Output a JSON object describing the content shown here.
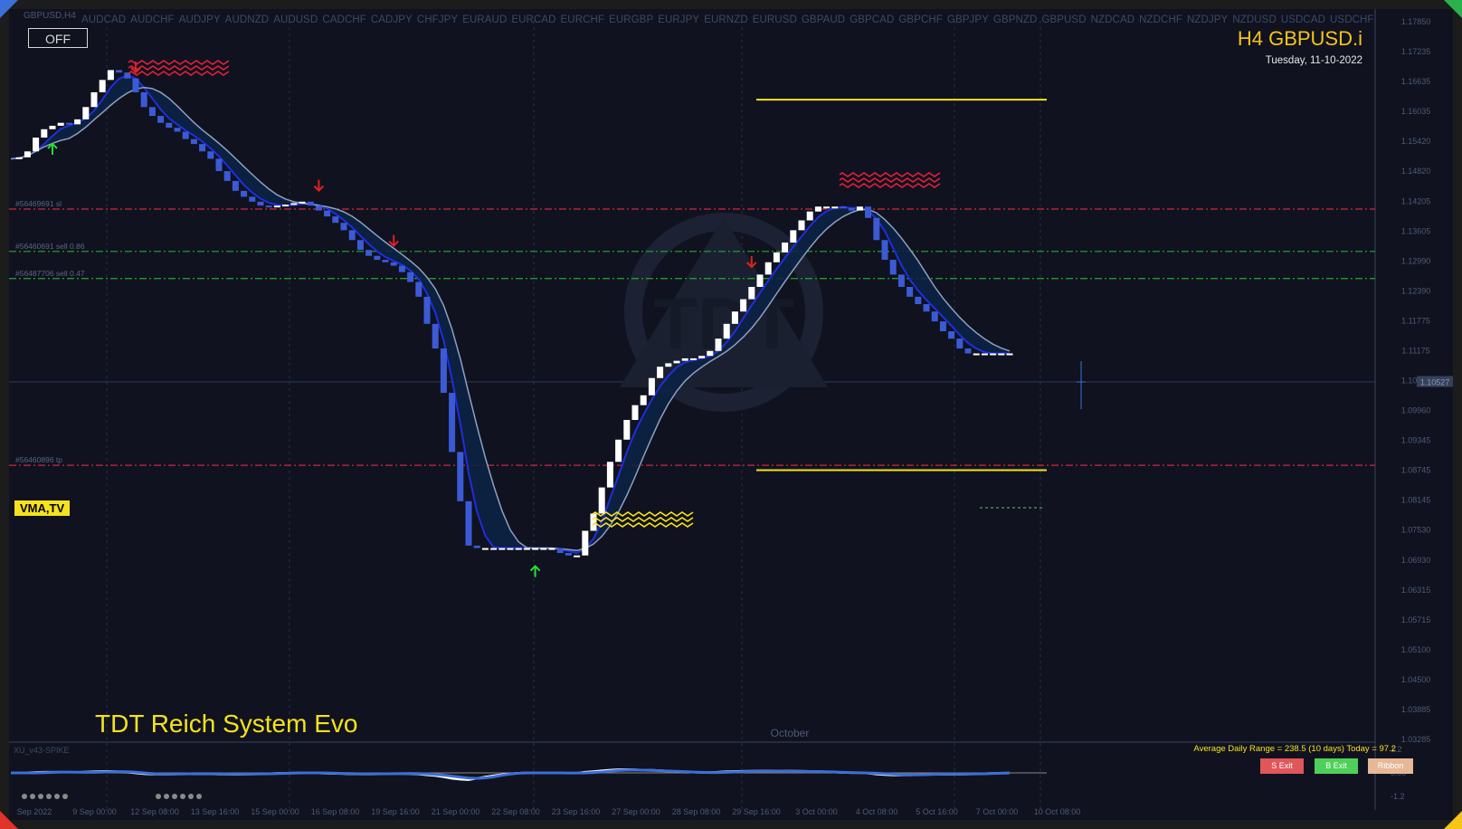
{
  "window": {
    "title": "GBPUSD,H4"
  },
  "symbols": [
    "AUDCAD",
    "AUDCHF",
    "AUDJPY",
    "AUDNZD",
    "AUDUSD",
    "CADCHF",
    "CADJPY",
    "CHFJPY",
    "EURAUD",
    "EURCAD",
    "EURCHF",
    "EURGBP",
    "EURJPY",
    "EURNZD",
    "EURUSD",
    "GBPAUD",
    "GBPCAD",
    "GBPCHF",
    "GBPJPY",
    "GBPNZD",
    "GBPUSD",
    "NZDCAD",
    "NZDCHF",
    "NZDJPY",
    "NZDUSD",
    "USDCAD",
    "USDCHF"
  ],
  "off_button": "OFF",
  "header": {
    "title": "H4 GBPUSD.i",
    "date": "Tuesday, 11-10-2022"
  },
  "badge": "VMA,TV",
  "system_title": "TDT Reich System Evo",
  "month_label": "October",
  "watermark": "TDT",
  "order_lines": [
    {
      "label": "#56469691 sl",
      "price": 1.1403,
      "color": "#d0283c"
    },
    {
      "label": "#56460691 sell 0.86",
      "price": 1.1317,
      "color": "#22aa33"
    },
    {
      "label": "#56487706 sell 0.47",
      "price": 1.1262,
      "color": "#22aa33"
    },
    {
      "label": "#56460896 tp",
      "price": 1.0883,
      "color": "#d0283c"
    }
  ],
  "current_price": "1.10527",
  "adr_text": "Average Daily Range = 238.5 (10 days)   Today = 97.2",
  "buttons": {
    "s_exit": "S Exit",
    "b_exit": "B Exit",
    "ribbon": "Ribbon"
  },
  "oscillator": {
    "label": "XU_v43-SPIKE",
    "ticks": [
      "1.2",
      "0.00",
      "-1.2"
    ]
  },
  "colors": {
    "background": "#10121f",
    "bear": "#3b5bd6",
    "bull": "#ffffff",
    "accent": "#f5c518"
  },
  "chart_data": {
    "type": "candlestick",
    "title": "H4 GBPUSD.i",
    "y_ticks": [
      "1.17850",
      "1.17235",
      "1.16635",
      "1.16035",
      "1.15420",
      "1.14820",
      "1.14205",
      "1.13605",
      "1.12990",
      "1.12390",
      "1.11775",
      "1.11175",
      "1.10560",
      "1.09960",
      "1.09345",
      "1.08745",
      "1.08145",
      "1.07530",
      "1.06930",
      "1.06315",
      "1.05715",
      "1.05100",
      "1.04500",
      "1.03885",
      "1.03285"
    ],
    "ylim": [
      1.03,
      1.18
    ],
    "x_ticks": [
      "Sep 2022",
      "9 Sep 00:00",
      "12 Sep 08:00",
      "13 Sep 16:00",
      "15 Sep 00:00",
      "16 Sep 08:00",
      "19 Sep 16:00",
      "21 Sep 00:00",
      "22 Sep 08:00",
      "23 Sep 16:00",
      "27 Sep 00:00",
      "28 Sep 08:00",
      "29 Sep 16:00",
      "3 Oct 00:00",
      "4 Oct 08:00",
      "5 Oct 16:00",
      "7 Oct 00:00",
      "10 Oct 08:00"
    ],
    "close": [
      1.1505,
      1.1508,
      1.152,
      1.1548,
      1.1565,
      1.1572,
      1.1578,
      1.1575,
      1.1585,
      1.161,
      1.164,
      1.1665,
      1.1685,
      1.168,
      1.1668,
      1.164,
      1.161,
      1.1592,
      1.1578,
      1.1568,
      1.156,
      1.1545,
      1.1535,
      1.152,
      1.1505,
      1.148,
      1.146,
      1.144,
      1.1428,
      1.1418,
      1.141,
      1.1408,
      1.141,
      1.1412,
      1.1415,
      1.1418,
      1.141,
      1.14,
      1.1388,
      1.1375,
      1.136,
      1.134,
      1.132,
      1.1308,
      1.13,
      1.1295,
      1.1288,
      1.1275,
      1.1255,
      1.1225,
      1.117,
      1.112,
      1.103,
      1.091,
      1.081,
      1.072,
      1.0715,
      1.0715,
      1.0715,
      1.0715,
      1.0715,
      1.0715,
      1.0715,
      1.0715,
      1.0715,
      1.0715,
      1.0705,
      1.07,
      1.07,
      1.075,
      1.0785,
      1.0838,
      1.089,
      1.0935,
      1.0975,
      1.1005,
      1.1025,
      1.106,
      1.1083,
      1.109,
      1.1095,
      1.11,
      1.11,
      1.1105,
      1.1115,
      1.114,
      1.117,
      1.1195,
      1.122,
      1.1245,
      1.127,
      1.1295,
      1.1315,
      1.1335,
      1.136,
      1.138,
      1.1398,
      1.1408,
      1.1408,
      1.1408,
      1.1405,
      1.14,
      1.1408,
      1.1385,
      1.134,
      1.13,
      1.127,
      1.1245,
      1.1225,
      1.121,
      1.1195,
      1.1175,
      1.1155,
      1.114,
      1.112,
      1.111,
      1.111,
      1.111,
      1.111,
      1.111,
      1.111
    ],
    "annotations": [
      {
        "type": "sell-arrow",
        "bar": 15
      },
      {
        "type": "buy-arrow",
        "bar": 5
      },
      {
        "type": "sell-arrow",
        "bar": 37
      },
      {
        "type": "sell-arrow",
        "bar": 46
      },
      {
        "type": "buy-arrow",
        "bar": 63
      },
      {
        "type": "sell-arrow",
        "bar": 89
      }
    ],
    "levels": [
      {
        "price": 1.1625,
        "color": "#f5e21c"
      },
      {
        "price": 1.0873,
        "color": "#f5e21c"
      }
    ]
  }
}
